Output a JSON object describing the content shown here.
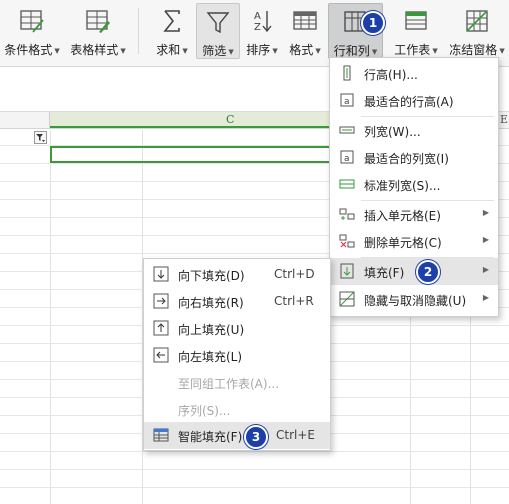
{
  "ribbon": {
    "buttons": [
      {
        "label": "条件格式",
        "icon": "conditional-format-icon"
      },
      {
        "label": "表格样式",
        "icon": "table-style-icon"
      },
      {
        "label": "求和",
        "icon": "sum-icon"
      },
      {
        "label": "筛选",
        "icon": "filter-icon"
      },
      {
        "label": "排序",
        "icon": "sort-icon"
      },
      {
        "label": "格式",
        "icon": "format-icon"
      },
      {
        "label": "行和列",
        "icon": "row-col-icon"
      },
      {
        "label": "工作表",
        "icon": "worksheet-icon"
      },
      {
        "label": "冻结窗格",
        "icon": "freeze-panes-icon"
      }
    ]
  },
  "sheet": {
    "column_c": "C",
    "column_e": "E"
  },
  "row_col_menu": {
    "items": [
      {
        "label": "行高(H)...",
        "icon": "row-height-icon"
      },
      {
        "label": "最适合的行高(A)",
        "icon": "best-fit-row-icon"
      },
      {
        "label": "列宽(W)...",
        "icon": "col-width-icon"
      },
      {
        "label": "最适合的列宽(I)",
        "icon": "best-fit-col-icon"
      },
      {
        "label": "标准列宽(S)...",
        "icon": "standard-width-icon"
      },
      {
        "label": "插入单元格(E)",
        "icon": "insert-cell-icon",
        "submenu": true
      },
      {
        "label": "删除单元格(C)",
        "icon": "delete-cell-icon",
        "submenu": true
      },
      {
        "label": "填充(F)",
        "icon": "fill-icon",
        "submenu": true,
        "highlighted": true
      },
      {
        "label": "隐藏与取消隐藏(U)",
        "icon": "hide-unhide-icon",
        "submenu": true
      }
    ]
  },
  "fill_menu": {
    "items": [
      {
        "label": "向下填充(D)",
        "shortcut": "Ctrl+D",
        "icon": "fill-down-icon"
      },
      {
        "label": "向右填充(R)",
        "shortcut": "Ctrl+R",
        "icon": "fill-right-icon"
      },
      {
        "label": "向上填充(U)",
        "shortcut": "",
        "icon": "fill-up-icon"
      },
      {
        "label": "向左填充(L)",
        "shortcut": "",
        "icon": "fill-left-icon"
      },
      {
        "label": "至同组工作表(A)...",
        "shortcut": "",
        "disabled": true
      },
      {
        "label": "序列(S)...",
        "shortcut": "",
        "disabled": true
      },
      {
        "label": "智能填充(F)",
        "shortcut": "Ctrl+E",
        "icon": "smart-fill-icon",
        "highlighted": true
      }
    ]
  },
  "badges": [
    "1",
    "2",
    "3"
  ],
  "colors": {
    "accent_green": "#3a9a3a",
    "badge_blue": "#1c3faa",
    "menu_highlight": "#e5e5e5"
  }
}
